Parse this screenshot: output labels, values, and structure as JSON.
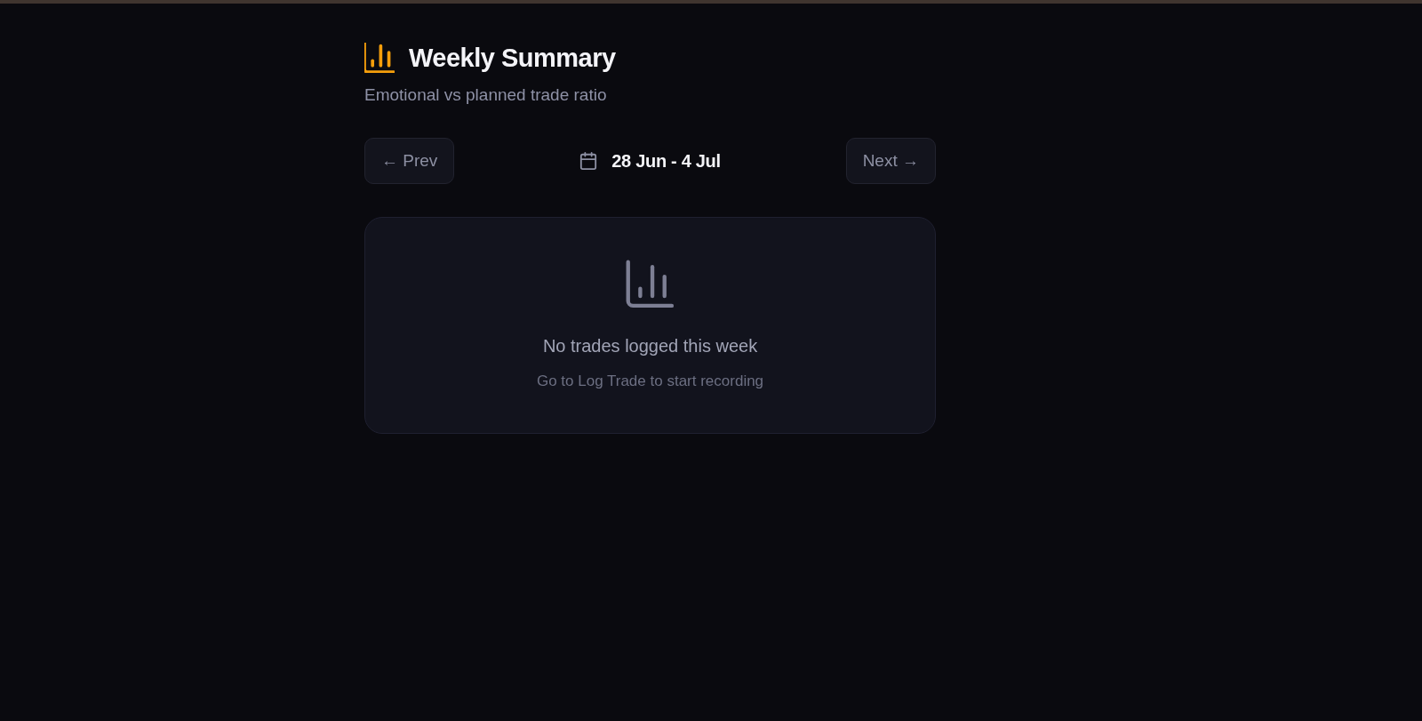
{
  "header": {
    "title": "Weekly Summary",
    "subtitle": "Emotional vs planned trade ratio"
  },
  "week_nav": {
    "prev": {
      "label": "← Prev"
    },
    "date_range": "28 Jun - 4 Jul",
    "next": {
      "label": "Next →"
    }
  },
  "empty_state": {
    "message": "No trades logged this week",
    "hint": "Go to Log Trade to start recording"
  }
}
